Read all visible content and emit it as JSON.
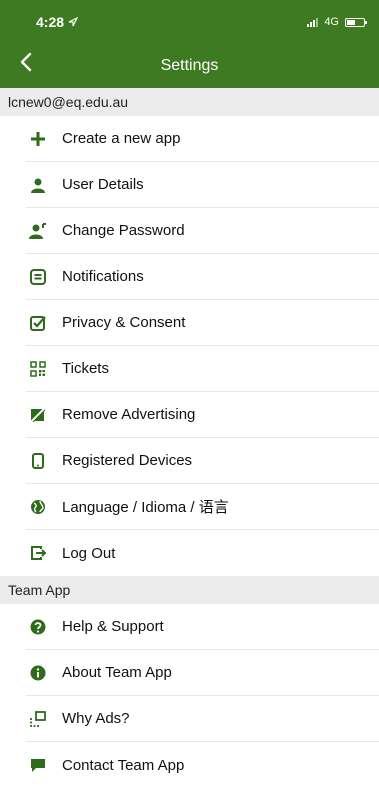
{
  "status": {
    "time": "4:28",
    "network": "4G"
  },
  "nav": {
    "title": "Settings"
  },
  "account": {
    "email": "lcnew0@eq.edu.au",
    "items": [
      {
        "label": "Create a new app",
        "icon": "plus-icon"
      },
      {
        "label": "User Details",
        "icon": "user-icon"
      },
      {
        "label": "Change Password",
        "icon": "user-key-icon"
      },
      {
        "label": "Notifications",
        "icon": "message-box-icon"
      },
      {
        "label": "Privacy & Consent",
        "icon": "check-square-icon"
      },
      {
        "label": "Tickets",
        "icon": "qr-code-icon"
      },
      {
        "label": "Remove Advertising",
        "icon": "no-ads-icon"
      },
      {
        "label": "Registered Devices",
        "icon": "mobile-device-icon"
      },
      {
        "label": "Language / Idioma / 语言",
        "icon": "globe-icon"
      },
      {
        "label": "Log Out",
        "icon": "logout-icon"
      }
    ]
  },
  "team_app": {
    "section_label": "Team App",
    "items": [
      {
        "label": "Help & Support",
        "icon": "question-circle-icon"
      },
      {
        "label": "About Team App",
        "icon": "info-circle-icon"
      },
      {
        "label": "Why Ads?",
        "icon": "ads-expand-icon"
      },
      {
        "label": "Contact Team App",
        "icon": "chat-bubble-icon"
      }
    ]
  },
  "colors": {
    "header": "#3d7a22",
    "icon": "#2e6b1a",
    "section_bg": "#ececec"
  }
}
